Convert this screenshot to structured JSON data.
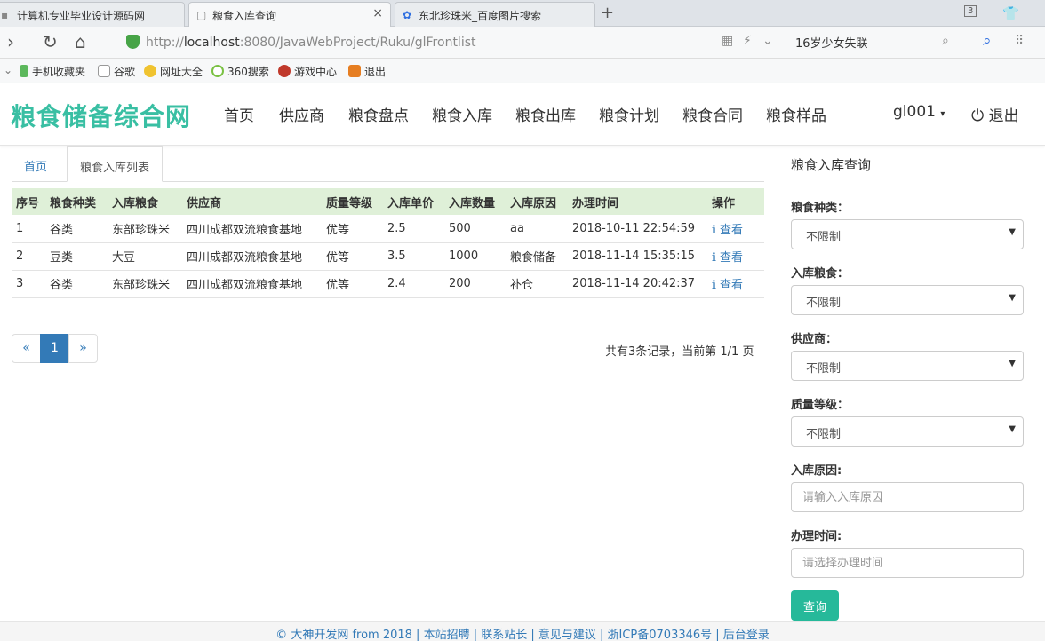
{
  "browser": {
    "tabs": [
      {
        "title": "计算机专业毕业设计源码网"
      },
      {
        "title": "粮食入库查询"
      },
      {
        "title": "东北珍珠米_百度图片搜索"
      }
    ],
    "tab_count": "3",
    "url_prefix": "http://",
    "url_host": "localhost",
    "url_rest": ":8080/JavaWebProject/Ruku/glFrontlist",
    "search_text": "16岁少女失联",
    "bookmarks": [
      "手机收藏夹",
      "谷歌",
      "网址大全",
      "360搜索",
      "游戏中心",
      "退出"
    ]
  },
  "site": {
    "brand": "粮食储备综合网",
    "nav": [
      "首页",
      "供应商",
      "粮食盘点",
      "粮食入库",
      "粮食出库",
      "粮食计划",
      "粮食合同",
      "粮食样品"
    ],
    "user": "gl001",
    "logout": "退出"
  },
  "content_tabs": {
    "home": "首页",
    "current": "粮食入库列表"
  },
  "table": {
    "headers": [
      "序号",
      "粮食种类",
      "入库粮食",
      "供应商",
      "质量等级",
      "入库单价",
      "入库数量",
      "入库原因",
      "办理时间",
      "操作"
    ],
    "rows": [
      [
        "1",
        "谷类",
        "东部珍珠米",
        "四川成都双流粮食基地",
        "优等",
        "2.5",
        "500",
        "aa",
        "2018-10-11 22:54:59",
        "查看"
      ],
      [
        "2",
        "豆类",
        "大豆",
        "四川成都双流粮食基地",
        "优等",
        "3.5",
        "1000",
        "粮食储备",
        "2018-11-14 15:35:15",
        "查看"
      ],
      [
        "3",
        "谷类",
        "东部珍珠米",
        "四川成都双流粮食基地",
        "优等",
        "2.4",
        "200",
        "补仓",
        "2018-11-14 20:42:37",
        "查看"
      ]
    ]
  },
  "pagination": {
    "prev": "«",
    "current": "1",
    "next": "»",
    "info": "共有3条记录，当前第 1/1 页"
  },
  "filter": {
    "title": "粮食入库查询",
    "grain_type_label": "粮食种类：",
    "grain_type_value": "不限制",
    "grain_label": "入库粮食：",
    "grain_value": "不限制",
    "supplier_label": "供应商：",
    "supplier_value": "不限制",
    "quality_label": "质量等级：",
    "quality_value": "不限制",
    "reason_label": "入库原因:",
    "reason_placeholder": "请输入入库原因",
    "time_label": "办理时间:",
    "time_placeholder": "请选择办理时间",
    "query_button": "查询"
  },
  "footer": {
    "text": "© 大神开发网 from 2018 | 本站招聘 | 联系站长 | 意见与建议 | 浙ICP备0703346号 | 后台登录"
  },
  "colors": {
    "brand": "#39bfa3",
    "table_header": "#dff0d8",
    "link": "#337ab7",
    "button": "#26b99a"
  }
}
